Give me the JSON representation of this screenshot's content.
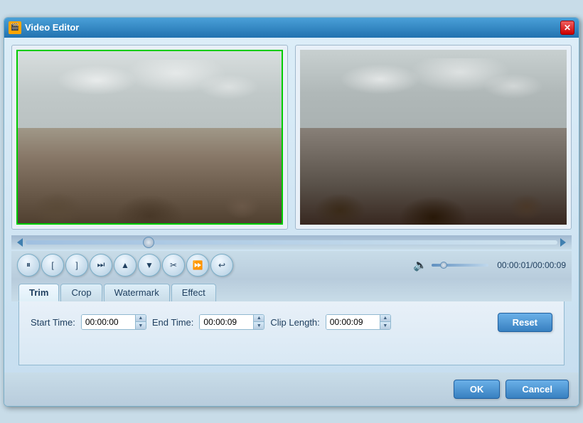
{
  "window": {
    "title": "Video Editor",
    "icon": "🎬"
  },
  "controls": {
    "pause_label": "⏸",
    "bracket_left_label": "[",
    "bracket_right_label": "]",
    "skip_next_label": "⏭",
    "arrow_up_label": "▲",
    "arrow_down_label": "▼",
    "cut_label": "✂",
    "skip_end_label": "⏩",
    "undo_label": "↩"
  },
  "seek": {
    "position_pct": 22
  },
  "volume": {
    "position_pct": 15
  },
  "time_display": "00:00:01/00:00:09",
  "tabs": [
    {
      "id": "trim",
      "label": "Trim",
      "active": true
    },
    {
      "id": "crop",
      "label": "Crop",
      "active": false
    },
    {
      "id": "watermark",
      "label": "Watermark",
      "active": false
    },
    {
      "id": "effect",
      "label": "Effect",
      "active": false
    }
  ],
  "trim": {
    "start_time_label": "Start Time:",
    "start_time_value": "00:00:00",
    "end_time_label": "End Time:",
    "end_time_value": "00:00:09",
    "clip_length_label": "Clip Length:",
    "clip_length_value": "00:00:09",
    "reset_label": "Reset"
  },
  "footer": {
    "ok_label": "OK",
    "cancel_label": "Cancel"
  }
}
